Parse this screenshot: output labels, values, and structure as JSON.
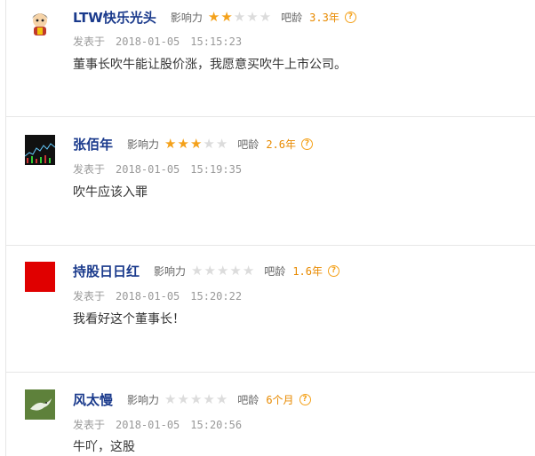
{
  "labels": {
    "influence": "影响力",
    "tenure": "吧龄",
    "posted": "发表于",
    "help": "?"
  },
  "comments": [
    {
      "username": "LTW快乐光头",
      "rating": 2,
      "tenure": "3.3年",
      "date": "2018-01-05",
      "time": "15:15:23",
      "text": "董事长吹牛能让股价涨，我愿意买吹牛上市公司。",
      "avatar": "cartoon-mascot"
    },
    {
      "username": "张佰年",
      "rating": 3,
      "tenure": "2.6年",
      "date": "2018-01-05",
      "time": "15:19:35",
      "text": "吹牛应该入罪",
      "avatar": "dark-chart"
    },
    {
      "username": "持股日日红",
      "rating": 0,
      "tenure": "1.6年",
      "date": "2018-01-05",
      "time": "15:20:22",
      "text": "我看好这个董事长！",
      "avatar": "red-square"
    },
    {
      "username": "风太慢",
      "rating": 0,
      "tenure": "6个月",
      "date": "2018-01-05",
      "time": "15:20:56",
      "text": "牛吖，这股",
      "avatar": "green-bird"
    }
  ],
  "colors": {
    "username": "#1a3a8c",
    "star_on": "#f4a11a",
    "star_off": "#dcdcdc",
    "tenure": "#e88a00",
    "time": "#999999"
  }
}
